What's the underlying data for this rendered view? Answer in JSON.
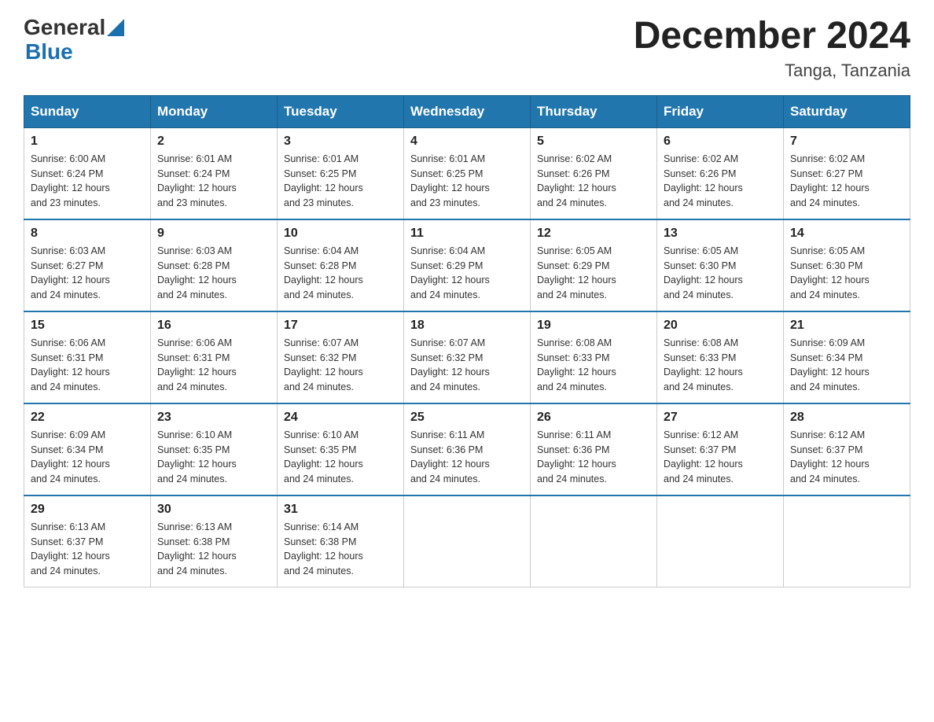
{
  "header": {
    "logo_general": "General",
    "logo_blue": "Blue",
    "month_title": "December 2024",
    "location": "Tanga, Tanzania"
  },
  "weekdays": [
    "Sunday",
    "Monday",
    "Tuesday",
    "Wednesday",
    "Thursday",
    "Friday",
    "Saturday"
  ],
  "weeks": [
    [
      {
        "day": "1",
        "sunrise": "6:00 AM",
        "sunset": "6:24 PM",
        "daylight": "12 hours and 23 minutes."
      },
      {
        "day": "2",
        "sunrise": "6:01 AM",
        "sunset": "6:24 PM",
        "daylight": "12 hours and 23 minutes."
      },
      {
        "day": "3",
        "sunrise": "6:01 AM",
        "sunset": "6:25 PM",
        "daylight": "12 hours and 23 minutes."
      },
      {
        "day": "4",
        "sunrise": "6:01 AM",
        "sunset": "6:25 PM",
        "daylight": "12 hours and 23 minutes."
      },
      {
        "day": "5",
        "sunrise": "6:02 AM",
        "sunset": "6:26 PM",
        "daylight": "12 hours and 24 minutes."
      },
      {
        "day": "6",
        "sunrise": "6:02 AM",
        "sunset": "6:26 PM",
        "daylight": "12 hours and 24 minutes."
      },
      {
        "day": "7",
        "sunrise": "6:02 AM",
        "sunset": "6:27 PM",
        "daylight": "12 hours and 24 minutes."
      }
    ],
    [
      {
        "day": "8",
        "sunrise": "6:03 AM",
        "sunset": "6:27 PM",
        "daylight": "12 hours and 24 minutes."
      },
      {
        "day": "9",
        "sunrise": "6:03 AM",
        "sunset": "6:28 PM",
        "daylight": "12 hours and 24 minutes."
      },
      {
        "day": "10",
        "sunrise": "6:04 AM",
        "sunset": "6:28 PM",
        "daylight": "12 hours and 24 minutes."
      },
      {
        "day": "11",
        "sunrise": "6:04 AM",
        "sunset": "6:29 PM",
        "daylight": "12 hours and 24 minutes."
      },
      {
        "day": "12",
        "sunrise": "6:05 AM",
        "sunset": "6:29 PM",
        "daylight": "12 hours and 24 minutes."
      },
      {
        "day": "13",
        "sunrise": "6:05 AM",
        "sunset": "6:30 PM",
        "daylight": "12 hours and 24 minutes."
      },
      {
        "day": "14",
        "sunrise": "6:05 AM",
        "sunset": "6:30 PM",
        "daylight": "12 hours and 24 minutes."
      }
    ],
    [
      {
        "day": "15",
        "sunrise": "6:06 AM",
        "sunset": "6:31 PM",
        "daylight": "12 hours and 24 minutes."
      },
      {
        "day": "16",
        "sunrise": "6:06 AM",
        "sunset": "6:31 PM",
        "daylight": "12 hours and 24 minutes."
      },
      {
        "day": "17",
        "sunrise": "6:07 AM",
        "sunset": "6:32 PM",
        "daylight": "12 hours and 24 minutes."
      },
      {
        "day": "18",
        "sunrise": "6:07 AM",
        "sunset": "6:32 PM",
        "daylight": "12 hours and 24 minutes."
      },
      {
        "day": "19",
        "sunrise": "6:08 AM",
        "sunset": "6:33 PM",
        "daylight": "12 hours and 24 minutes."
      },
      {
        "day": "20",
        "sunrise": "6:08 AM",
        "sunset": "6:33 PM",
        "daylight": "12 hours and 24 minutes."
      },
      {
        "day": "21",
        "sunrise": "6:09 AM",
        "sunset": "6:34 PM",
        "daylight": "12 hours and 24 minutes."
      }
    ],
    [
      {
        "day": "22",
        "sunrise": "6:09 AM",
        "sunset": "6:34 PM",
        "daylight": "12 hours and 24 minutes."
      },
      {
        "day": "23",
        "sunrise": "6:10 AM",
        "sunset": "6:35 PM",
        "daylight": "12 hours and 24 minutes."
      },
      {
        "day": "24",
        "sunrise": "6:10 AM",
        "sunset": "6:35 PM",
        "daylight": "12 hours and 24 minutes."
      },
      {
        "day": "25",
        "sunrise": "6:11 AM",
        "sunset": "6:36 PM",
        "daylight": "12 hours and 24 minutes."
      },
      {
        "day": "26",
        "sunrise": "6:11 AM",
        "sunset": "6:36 PM",
        "daylight": "12 hours and 24 minutes."
      },
      {
        "day": "27",
        "sunrise": "6:12 AM",
        "sunset": "6:37 PM",
        "daylight": "12 hours and 24 minutes."
      },
      {
        "day": "28",
        "sunrise": "6:12 AM",
        "sunset": "6:37 PM",
        "daylight": "12 hours and 24 minutes."
      }
    ],
    [
      {
        "day": "29",
        "sunrise": "6:13 AM",
        "sunset": "6:37 PM",
        "daylight": "12 hours and 24 minutes."
      },
      {
        "day": "30",
        "sunrise": "6:13 AM",
        "sunset": "6:38 PM",
        "daylight": "12 hours and 24 minutes."
      },
      {
        "day": "31",
        "sunrise": "6:14 AM",
        "sunset": "6:38 PM",
        "daylight": "12 hours and 24 minutes."
      },
      null,
      null,
      null,
      null
    ]
  ],
  "labels": {
    "sunrise": "Sunrise:",
    "sunset": "Sunset:",
    "daylight": "Daylight:"
  }
}
